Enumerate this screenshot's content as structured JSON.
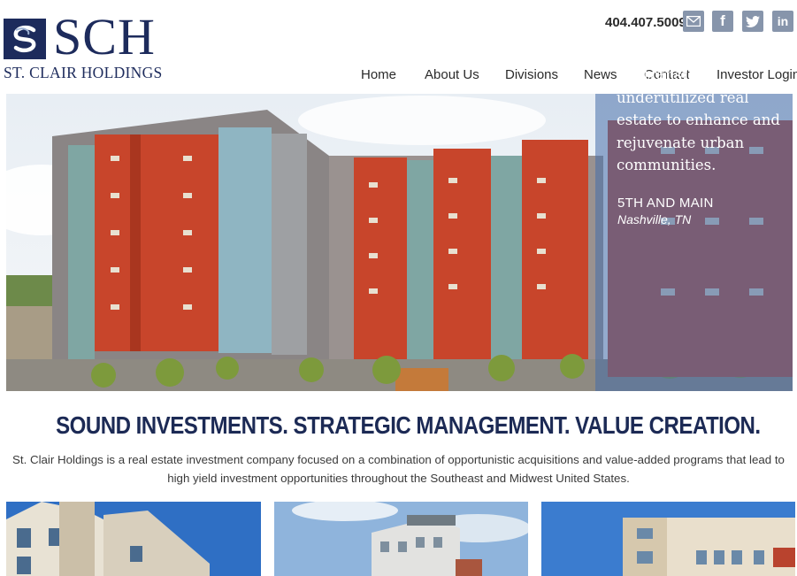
{
  "brand": {
    "initials": "SCH",
    "name": "ST. CLAIR HOLDINGS",
    "navy": "#1d2b5c"
  },
  "contact": {
    "phone": "404.407.5009"
  },
  "social": [
    {
      "icon": "email-icon"
    },
    {
      "icon": "facebook-icon",
      "glyph": "f"
    },
    {
      "icon": "twitter-icon"
    },
    {
      "icon": "linkedin-icon",
      "glyph": "in"
    }
  ],
  "nav": {
    "items": [
      "Home",
      "About Us",
      "Divisions",
      "News",
      "Contact",
      "Investor Login"
    ]
  },
  "hero": {
    "tagline": "We transform underutilized real estate to enhance and rejuvenate urban communities.",
    "project": "5TH AND MAIN",
    "location": "Nashville, TN"
  },
  "headline": "SOUND INVESTMENTS. STRATEGIC MANAGEMENT. VALUE CREATION.",
  "intro": "St. Clair Holdings is a real estate investment company focused on a combination of opportunistic acquisitions and value-added programs that lead to high yield investment opportunities throughout the Southeast and Midwest United States.",
  "colors": {
    "accent": "#1c2a55",
    "social_bg": "#8795ab",
    "brick": "#c8452b"
  }
}
